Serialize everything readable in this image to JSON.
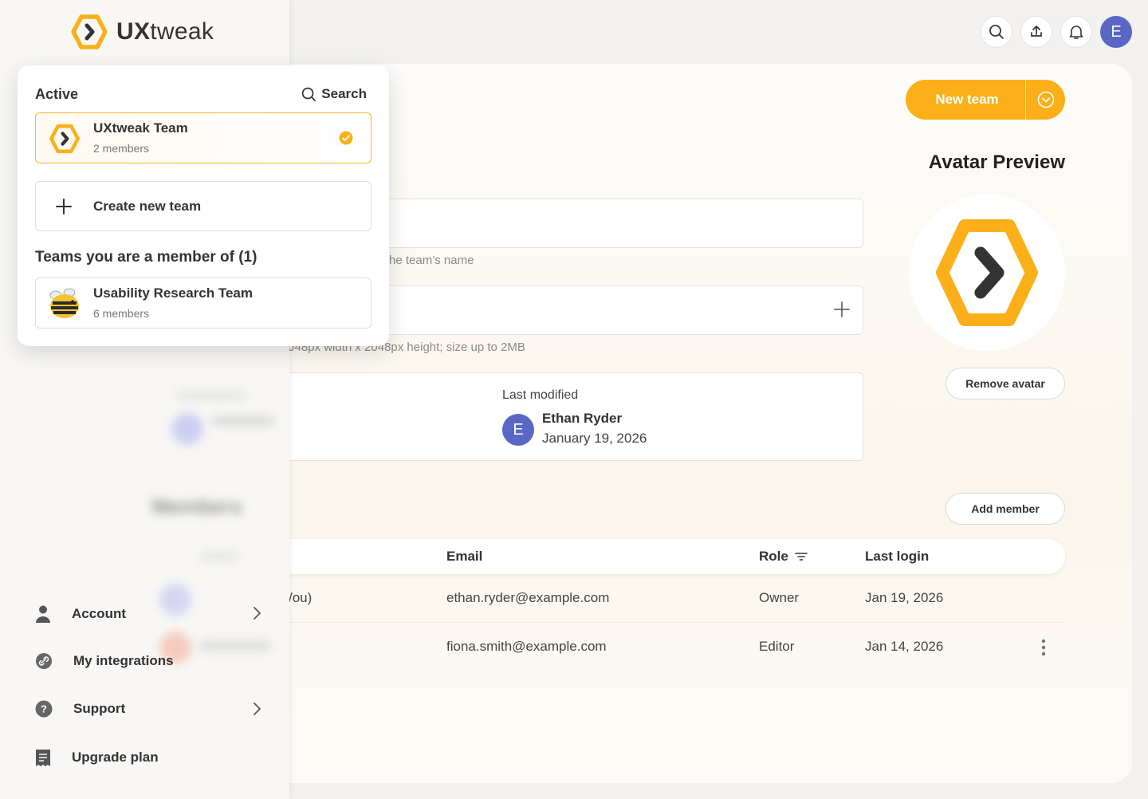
{
  "app": {
    "logo_text_bold": "UX",
    "logo_text_light": "tweak",
    "user_initial": "E"
  },
  "topbar": {
    "icons": [
      "search-icon",
      "upload-icon",
      "bell-icon"
    ]
  },
  "main": {
    "new_team_label": "New team",
    "avatar_preview_title": "Avatar Preview",
    "remove_avatar_label": "Remove avatar",
    "add_member_label": "Add member",
    "name_hint": "he team’s name",
    "image_hint": "J48px width x 2048px height; size up to 2MB",
    "last_modified": {
      "label": "Last modified",
      "initial": "E",
      "name": "Ethan Ryder",
      "date": "January 19, 2026"
    },
    "table": {
      "headers": {
        "email": "Email",
        "role": "Role",
        "last_login": "Last login"
      },
      "rows": [
        {
          "name": "/ou)",
          "email": "ethan.ryder@example.com",
          "role": "Owner",
          "last_login": "Jan 19, 2026"
        },
        {
          "name": "",
          "email": "fiona.smith@example.com",
          "role": "Editor",
          "last_login": "Jan 14, 2026"
        }
      ]
    },
    "accent_color": "#fbb01a"
  },
  "sidebar": {
    "blurred_title": "Members",
    "nav": [
      {
        "label": "Account",
        "icon": "person-icon"
      },
      {
        "label": "My integrations",
        "icon": "link-icon"
      },
      {
        "label": "Support",
        "icon": "help-icon"
      },
      {
        "label": "Upgrade plan",
        "icon": "receipt-icon"
      }
    ]
  },
  "dropdown": {
    "active_label": "Active",
    "search_label": "Search",
    "active_team": {
      "name": "UXtweak Team",
      "members": "2 members"
    },
    "create_label": "Create new team",
    "member_title": "Teams you are a member of (1)",
    "member_team": {
      "name": "Usability Research Team",
      "members": "6 members"
    }
  }
}
